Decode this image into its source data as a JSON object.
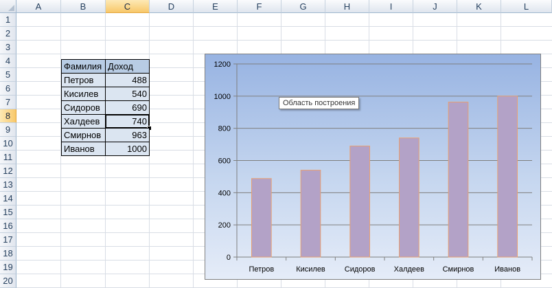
{
  "columns": [
    "A",
    "B",
    "C",
    "D",
    "E",
    "F",
    "G",
    "H",
    "I",
    "J",
    "K",
    "L"
  ],
  "rows": [
    "1",
    "2",
    "3",
    "4",
    "5",
    "6",
    "7",
    "8",
    "9",
    "10",
    "11",
    "12",
    "13",
    "14",
    "15",
    "16",
    "17",
    "18",
    "19",
    "20"
  ],
  "selected_column": "C",
  "selected_row": "8",
  "table": {
    "headers": [
      "Фамилия",
      "Доход"
    ],
    "rows": [
      {
        "name": "Петров",
        "value": "488"
      },
      {
        "name": "Кисилев",
        "value": "540"
      },
      {
        "name": "Сидоров",
        "value": "690"
      },
      {
        "name": "Халдеев",
        "value": "740"
      },
      {
        "name": "Смирнов",
        "value": "963"
      },
      {
        "name": "Иванов",
        "value": "1000"
      }
    ]
  },
  "chart_data": {
    "type": "bar",
    "categories": [
      "Петров",
      "Кисилев",
      "Сидоров",
      "Халдеев",
      "Смирнов",
      "Иванов"
    ],
    "values": [
      488,
      540,
      690,
      740,
      963,
      1000
    ],
    "ylim": [
      0,
      1200
    ],
    "yticks": [
      "0",
      "200",
      "400",
      "600",
      "800",
      "1000",
      "1200"
    ],
    "grid": true,
    "title": "",
    "xlabel": "",
    "ylabel": "",
    "bar_color": "#b3a2c7",
    "bar_border": "#e8a072"
  },
  "tooltip": "Область построения"
}
